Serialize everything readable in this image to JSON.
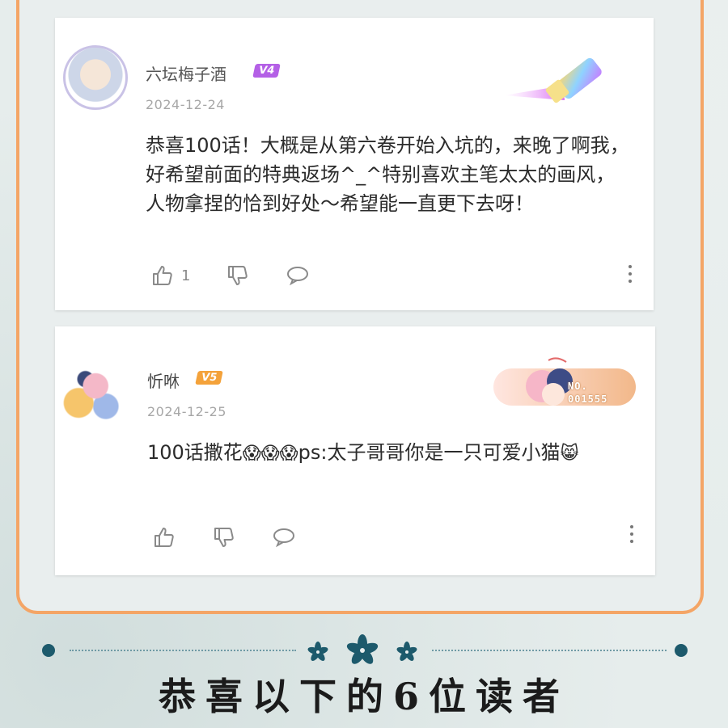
{
  "comments": [
    {
      "username": "六坛梅子酒",
      "level": "V4",
      "date": "2024-12-24",
      "content": "恭喜100话！大概是从第六卷开始入坑的，来晚了啊我，好希望前面的特典返场^_^特别喜欢主笔太太的画风，人物拿捏的恰到好处～希望能一直更下去呀！",
      "like_count": "1"
    },
    {
      "username": "忻咻",
      "level": "V5",
      "date": "2024-12-25",
      "content_before": "100话撒花",
      "content_emoji": "😱😱😱",
      "content_after": "ps:太子哥哥你是一只可爱小猫",
      "content_end_emoji": "😸",
      "badge_text": "NO. 001555"
    }
  ],
  "footer": {
    "title": "恭喜以下的6位读者"
  },
  "colors": {
    "frame": "#f4a566",
    "v4": "#b460e6",
    "v5": "#f4a23a",
    "divider": "#1d5a6c"
  },
  "icons": [
    "thumb-up-icon",
    "thumb-down-icon",
    "comment-icon",
    "more-icon",
    "flower-icon"
  ]
}
